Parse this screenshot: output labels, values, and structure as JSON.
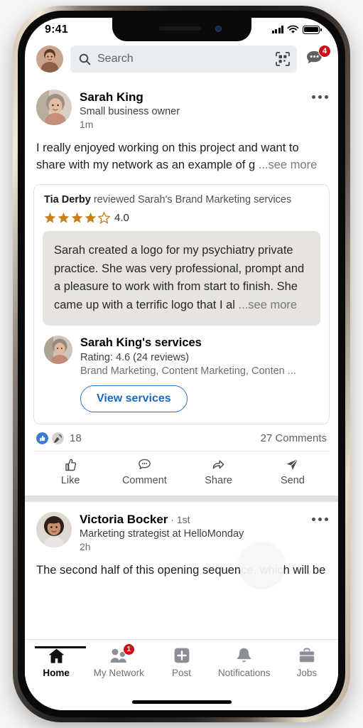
{
  "status_bar": {
    "time": "9:41",
    "signal_icon": "cellular-bars-icon",
    "wifi_icon": "wifi-icon",
    "battery_icon": "battery-full-icon"
  },
  "app_bar": {
    "avatar_name": "me-avatar",
    "search": {
      "placeholder": "Search",
      "icon": "search-icon",
      "qr_icon": "qr-scan-icon"
    },
    "messaging": {
      "icon": "messaging-icon",
      "badge": "4"
    }
  },
  "posts": [
    {
      "author": "Sarah King",
      "headline": "Small business owner",
      "time": "1m",
      "degree": "",
      "menu_icon": "overflow-menu-icon",
      "text": "I really enjoyed working on this project and want to share with my network as an example of g",
      "see_more": "...see more",
      "review_card": {
        "reviewer": "Tia Derby",
        "review_intro": " reviewed Sarah's Brand Marketing services",
        "rating_value": "4.0",
        "stars_filled": 4,
        "stars_total": 5,
        "star_color": "#c8801a",
        "quote": "Sarah created a logo for my psychiatry private practice. She was very professional, prompt and a pleasure to work with from start to finish. She came up with a terrific logo that I al",
        "quote_see_more": "...see more",
        "service_title": "Sarah King's services",
        "service_rating": "Rating: 4.6 (24 reviews)",
        "service_tags": "Brand Marketing, Content Marketing, Conten ...",
        "cta_label": "View services"
      },
      "reactions_count": "18",
      "comments_count": "27 Comments",
      "reaction_icons": [
        "like-reaction-icon",
        "celebrate-reaction-icon"
      ],
      "actions": [
        {
          "label": "Like",
          "icon": "thumbs-up-icon"
        },
        {
          "label": "Comment",
          "icon": "comment-bubble-icon"
        },
        {
          "label": "Share",
          "icon": "share-arrow-icon"
        },
        {
          "label": "Send",
          "icon": "send-paperplane-icon"
        }
      ]
    },
    {
      "author": "Victoria Bocker",
      "degree": " · 1st",
      "headline": "Marketing strategist at HelloMonday",
      "time": "2h",
      "menu_icon": "overflow-menu-icon",
      "text": "The second half of this opening sequence, which will be"
    }
  ],
  "bottom_nav": [
    {
      "label": "Home",
      "icon": "home-icon",
      "active": true,
      "badge": ""
    },
    {
      "label": "My Network",
      "icon": "my-network-icon",
      "active": false,
      "badge": "1"
    },
    {
      "label": "Post",
      "icon": "post-plus-icon",
      "active": false,
      "badge": ""
    },
    {
      "label": "Notifications",
      "icon": "bell-icon",
      "active": false,
      "badge": ""
    },
    {
      "label": "Jobs",
      "icon": "briefcase-icon",
      "active": false,
      "badge": ""
    }
  ],
  "colors": {
    "accent": "#0a66c2",
    "badge_red": "#cc1016",
    "star": "#c8801a",
    "quote_bg": "#e7e3de"
  }
}
